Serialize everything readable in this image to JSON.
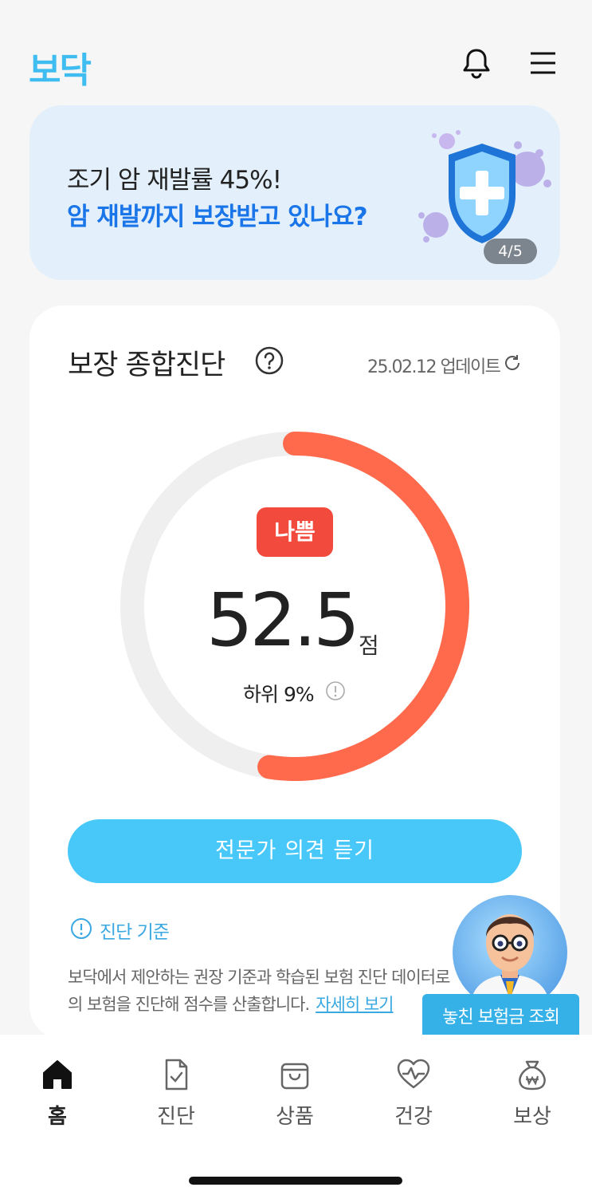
{
  "header": {
    "logo": "보닥"
  },
  "banner": {
    "line1": "조기 암 재발률 45%!",
    "line2": "암 재발까지 보장받고 있나요?",
    "pager": "4/5"
  },
  "diagnosis": {
    "title": "보장 종합진단",
    "updated": "25.02.12 업데이트",
    "status_badge": "나쁨",
    "score": "52.5",
    "score_unit": "점",
    "score_fraction": 0.525,
    "rank": "하위 9%",
    "cta_label": "전문가 의견 듣기",
    "criteria_label": "진단 기준",
    "description_line1": "보닥에서 제안하는 권장 기준과 학습된 보험 진단 데이터로",
    "description_line2": "의 보험을 진단해 점수를 산출합니다.",
    "more_link": "자세히 보기"
  },
  "floating": {
    "tooltip": "놓친 보험금 조회"
  },
  "tabs": [
    {
      "label": "홈",
      "icon": "home-icon",
      "active": true
    },
    {
      "label": "진단",
      "icon": "document-check-icon",
      "active": false
    },
    {
      "label": "상품",
      "icon": "shopping-bag-icon",
      "active": false
    },
    {
      "label": "건강",
      "icon": "heart-pulse-icon",
      "active": false
    },
    {
      "label": "보상",
      "icon": "money-bag-icon",
      "active": false
    }
  ],
  "colors": {
    "accent": "#3fbdf1",
    "cta": "#47c8f9",
    "bad": "#f24a3c",
    "gauge": "#ff6a4d",
    "gauge_track": "#efefef",
    "banner_bg": "#e3f0fb",
    "banner_highlight": "#1a75e8"
  }
}
